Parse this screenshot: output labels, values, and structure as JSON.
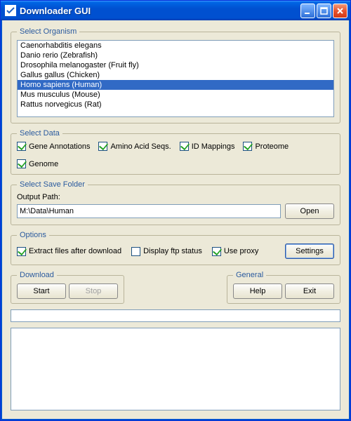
{
  "window": {
    "title": "Downloader GUI"
  },
  "organism": {
    "legend": "Select Organism",
    "items": [
      "Caenorhabditis elegans",
      "Danio rerio (Zebrafish)",
      "Drosophila melanogaster (Fruit fly)",
      "Gallus gallus (Chicken)",
      "Homo sapiens (Human)",
      "Mus musculus (Mouse)",
      "Rattus norvegicus (Rat)"
    ],
    "selected_index": 4
  },
  "data": {
    "legend": "Select Data",
    "checks": [
      {
        "label": "Gene Annotations",
        "checked": true
      },
      {
        "label": "Amino Acid Seqs.",
        "checked": true
      },
      {
        "label": "ID Mappings",
        "checked": true
      },
      {
        "label": "Proteome",
        "checked": true
      },
      {
        "label": "Genome",
        "checked": true
      }
    ]
  },
  "save": {
    "legend": "Select Save Folder",
    "label": "Output Path:",
    "value": "M:\\Data\\Human",
    "open_label": "Open"
  },
  "options": {
    "legend": "Options",
    "extract": {
      "label": "Extract files after download",
      "checked": true
    },
    "ftp": {
      "label": "Display ftp status",
      "checked": false
    },
    "proxy": {
      "label": "Use proxy",
      "checked": true
    },
    "settings_label": "Settings"
  },
  "download": {
    "legend": "Download",
    "start": "Start",
    "stop": "Stop"
  },
  "general": {
    "legend": "General",
    "help": "Help",
    "exit": "Exit"
  }
}
